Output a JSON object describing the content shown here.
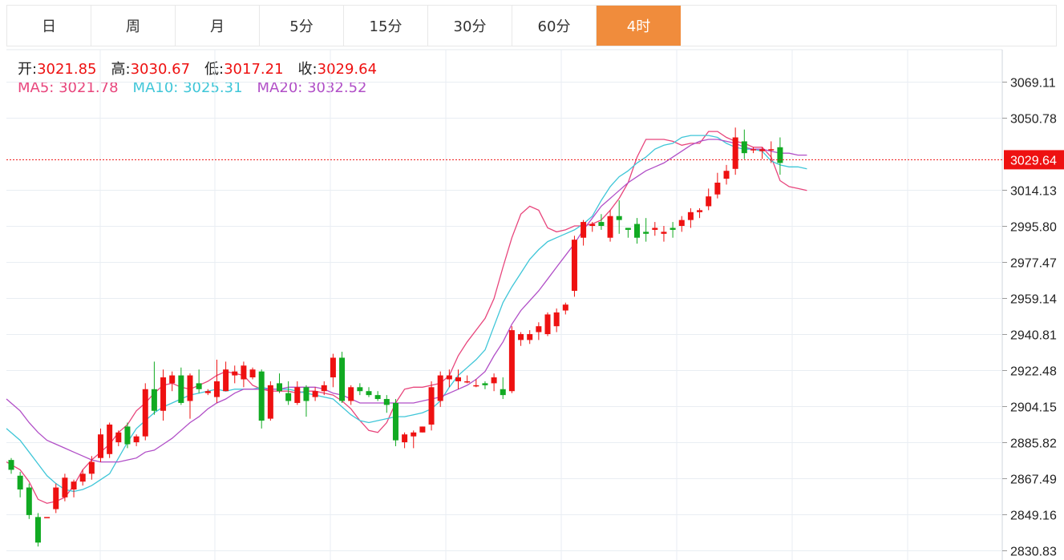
{
  "tabs": [
    {
      "label": "日",
      "active": false
    },
    {
      "label": "周",
      "active": false
    },
    {
      "label": "月",
      "active": false
    },
    {
      "label": "5分",
      "active": false
    },
    {
      "label": "15分",
      "active": false
    },
    {
      "label": "30分",
      "active": false
    },
    {
      "label": "60分",
      "active": false
    },
    {
      "label": "4时",
      "active": true
    }
  ],
  "info": {
    "open_label": "开:",
    "open_value": "3021.85",
    "high_label": "高:",
    "high_value": "3030.67",
    "low_label": "低:",
    "low_value": "3017.21",
    "close_label": "收:",
    "close_value": "3029.64",
    "ma5_label": "MA5:",
    "ma5_value": "3021.78",
    "ma10_label": "MA10:",
    "ma10_value": "3025.31",
    "ma20_label": "MA20:",
    "ma20_value": "3032.52"
  },
  "colors": {
    "up": "#ee1111",
    "down": "#11aa22",
    "ma5": "#e8457c",
    "ma10": "#3fc6d8",
    "ma20": "#b14fc7",
    "price_tag": "#ee1111",
    "tab_active": "#f08c3c",
    "grid": "#e9eef3"
  },
  "chart_data": {
    "type": "candlestick",
    "y_ticks": [
      "3069.11",
      "3050.78",
      "3029.64",
      "3014.13",
      "2995.80",
      "2977.47",
      "2959.14",
      "2940.81",
      "2922.48",
      "2904.15",
      "2885.82",
      "2867.49",
      "2849.16",
      "2830.83"
    ],
    "ylim": [
      2830.83,
      3069.11
    ],
    "current_price": "3029.64",
    "grid": true,
    "series": [
      {
        "name": "MA5",
        "values": [
          2876,
          2872,
          2866,
          2857,
          2855,
          2856,
          2858,
          2864,
          2872,
          2877,
          2881,
          2885,
          2891,
          2895,
          2902,
          2906,
          2911,
          2915,
          2916,
          2914,
          2913,
          2915,
          2917,
          2920,
          2922,
          2921,
          2920,
          2915,
          2913,
          2912,
          2912,
          2912,
          2911,
          2912,
          2912,
          2911,
          2910,
          2907,
          2903,
          2897,
          2892,
          2891,
          2896,
          2906,
          2913,
          2914,
          2914,
          2915,
          2916,
          2920,
          2930,
          2937,
          2943,
          2949,
          2959,
          2975,
          2990,
          3002,
          3006,
          3004,
          2995,
          2993,
          2994,
          2996,
          2996,
          2997,
          2999,
          3004,
          3010,
          3018,
          3031,
          3040,
          3040,
          3040,
          3039,
          3037,
          3038,
          3038,
          3044,
          3044,
          3041,
          3039,
          3038,
          3036,
          3036,
          3031,
          3019,
          3016,
          3015,
          3014
        ]
      },
      {
        "name": "MA10",
        "values": [
          2893,
          2887,
          2881,
          2875,
          2869,
          2865,
          2862,
          2861,
          2862,
          2864,
          2867,
          2870,
          2878,
          2886,
          2893,
          2897,
          2901,
          2904,
          2906,
          2908,
          2910,
          2911,
          2912,
          2913,
          2912,
          2913,
          2913,
          2913,
          2914,
          2913,
          2913,
          2913,
          2912,
          2911,
          2910,
          2909,
          2908,
          2904,
          2900,
          2897,
          2896,
          2897,
          2898,
          2899,
          2899,
          2900,
          2901,
          2903,
          2907,
          2914,
          2920,
          2924,
          2928,
          2933,
          2945,
          2957,
          2965,
          2972,
          2979,
          2984,
          2988,
          2990,
          2992,
          2994,
          2997,
          3001,
          3009,
          3016,
          3021,
          3024,
          3028,
          3031,
          3035,
          3037,
          3038,
          3041,
          3042,
          3042,
          3042,
          3041,
          3038,
          3036,
          3035,
          3035,
          3034,
          3029,
          3027,
          3026,
          3026,
          3025
        ]
      },
      {
        "name": "MA20",
        "values": [
          2908,
          2902,
          2896,
          2891,
          2887,
          2885,
          2883,
          2881,
          2879,
          2877,
          2876,
          2876,
          2876,
          2877,
          2878,
          2881,
          2882,
          2885,
          2888,
          2892,
          2896,
          2899,
          2903,
          2906,
          2908,
          2911,
          2913,
          2913,
          2913,
          2913,
          2913,
          2914,
          2914,
          2914,
          2914,
          2913,
          2911,
          2910,
          2908,
          2906,
          2906,
          2906,
          2906,
          2906,
          2906,
          2906,
          2907,
          2908,
          2909,
          2911,
          2913,
          2915,
          2918,
          2922,
          2930,
          2937,
          2946,
          2953,
          2958,
          2963,
          2969,
          2975,
          2981,
          2987,
          2994,
          3000,
          3006,
          3010,
          3014,
          3018,
          3021,
          3024,
          3026,
          3028,
          3031,
          3034,
          3037,
          3039,
          3040,
          3040,
          3039,
          3038,
          3036,
          3035,
          3035,
          3034,
          3033,
          3033,
          3032,
          3032
        ]
      }
    ],
    "candles": [
      [
        2877,
        2872,
        2878,
        2870
      ],
      [
        2869,
        2862,
        2871,
        2858
      ],
      [
        2863,
        2849,
        2865,
        2847
      ],
      [
        2848,
        2835,
        2850,
        2833
      ],
      [
        2848,
        2848,
        2848,
        2848
      ],
      [
        2852,
        2863,
        2865,
        2850
      ],
      [
        2858,
        2868,
        2870,
        2856
      ],
      [
        2862,
        2866,
        2867,
        2858
      ],
      [
        2866,
        2870,
        2872,
        2864
      ],
      [
        2870,
        2876,
        2879,
        2867
      ],
      [
        2878,
        2890,
        2893,
        2876
      ],
      [
        2880,
        2895,
        2896,
        2878
      ],
      [
        2886,
        2891,
        2892,
        2884
      ],
      [
        2894,
        2885,
        2896,
        2883
      ],
      [
        2886,
        2889,
        2890,
        2884
      ],
      [
        2889,
        2913,
        2916,
        2887
      ],
      [
        2913,
        2902,
        2927,
        2900
      ],
      [
        2902,
        2919,
        2923,
        2897
      ],
      [
        2916,
        2920,
        2922,
        2912
      ],
      [
        2920,
        2906,
        2924,
        2905
      ],
      [
        2907,
        2920,
        2921,
        2898
      ],
      [
        2916,
        2913,
        2923,
        2911
      ],
      [
        2911,
        2912,
        2913,
        2910
      ],
      [
        2909,
        2917,
        2928,
        2906
      ],
      [
        2912,
        2923,
        2927,
        2912
      ],
      [
        2920,
        2922,
        2925,
        2916
      ],
      [
        2918,
        2925,
        2927,
        2914
      ],
      [
        2919,
        2923,
        2924,
        2918
      ],
      [
        2922,
        2897,
        2923,
        2893
      ],
      [
        2898,
        2915,
        2917,
        2897
      ],
      [
        2916,
        2912,
        2921,
        2911
      ],
      [
        2911,
        2907,
        2917,
        2905
      ],
      [
        2906,
        2914,
        2917,
        2905
      ],
      [
        2914,
        2907,
        2915,
        2899
      ],
      [
        2909,
        2912,
        2914,
        2907
      ],
      [
        2912,
        2915,
        2917,
        2910
      ],
      [
        2919,
        2929,
        2931,
        2914
      ],
      [
        2929,
        2907,
        2932,
        2906
      ],
      [
        2907,
        2914,
        2915,
        2905
      ],
      [
        2914,
        2912,
        2916,
        2910
      ],
      [
        2912,
        2910,
        2914,
        2909
      ],
      [
        2910,
        2908,
        2912,
        2907
      ],
      [
        2908,
        2905,
        2910,
        2901
      ],
      [
        2906,
        2887,
        2908,
        2884
      ],
      [
        2886,
        2890,
        2891,
        2883
      ],
      [
        2889,
        2891,
        2892,
        2883
      ],
      [
        2891,
        2894,
        2894,
        2891
      ],
      [
        2895,
        2914,
        2917,
        2892
      ],
      [
        2907,
        2920,
        2922,
        2904
      ],
      [
        2918,
        2920,
        2923,
        2914
      ],
      [
        2917,
        2919,
        2923,
        2913
      ],
      [
        2917,
        2917,
        2920,
        2916
      ],
      [
        2915,
        2915,
        2918,
        2914
      ],
      [
        2916,
        2915,
        2917,
        2913
      ],
      [
        2916,
        2919,
        2921,
        2912
      ],
      [
        2913,
        2910,
        2919,
        2908
      ],
      [
        2912,
        2943,
        2945,
        2911
      ],
      [
        2938,
        2941,
        2942,
        2935
      ],
      [
        2938,
        2941,
        2943,
        2936
      ],
      [
        2942,
        2945,
        2947,
        2938
      ],
      [
        2941,
        2951,
        2952,
        2940
      ],
      [
        2945,
        2952,
        2954,
        2942
      ],
      [
        2953,
        2956,
        2957,
        2951
      ],
      [
        2963,
        2989,
        2991,
        2960
      ],
      [
        2990,
        2998,
        2999,
        2986
      ],
      [
        2996,
        2997,
        2998,
        2993
      ],
      [
        2998,
        2996,
        3002,
        2994
      ],
      [
        2990,
        3001,
        3004,
        2988
      ],
      [
        3001,
        2999,
        3009,
        2992
      ],
      [
        2995,
        2994,
        2995,
        2990
      ],
      [
        2997,
        2990,
        3000,
        2987
      ],
      [
        2993,
        2992,
        3000,
        2988
      ],
      [
        2994,
        2995,
        2998,
        2991
      ],
      [
        2992,
        2993,
        2996,
        2988
      ],
      [
        2995,
        2994,
        2998,
        2990
      ],
      [
        2996,
        2999,
        3001,
        2993
      ],
      [
        2999,
        3003,
        3005,
        2995
      ],
      [
        3003,
        3004,
        3005,
        3000
      ],
      [
        3006,
        3011,
        3015,
        3004
      ],
      [
        3012,
        3018,
        3023,
        3010
      ],
      [
        3020,
        3024,
        3027,
        3017
      ],
      [
        3025,
        3041,
        3046,
        3022
      ],
      [
        3039,
        3033,
        3045,
        3030
      ],
      [
        3035,
        3035,
        3036,
        3033
      ],
      [
        3034,
        3035,
        3036,
        3030
      ],
      [
        3035,
        3035,
        3039,
        3028
      ],
      [
        3036,
        3028,
        3041,
        3022
      ]
    ]
  }
}
